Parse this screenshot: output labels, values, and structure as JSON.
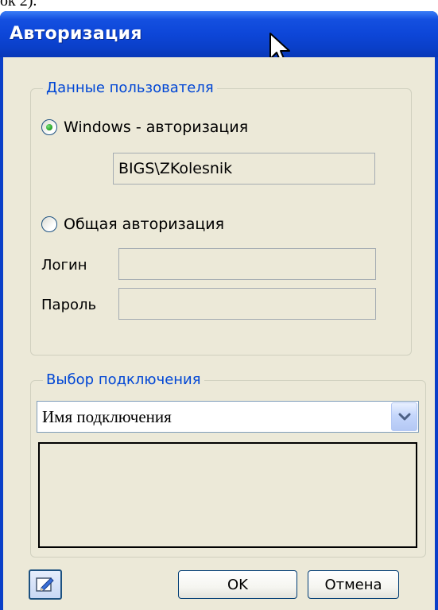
{
  "page_fragment": "ок 2).",
  "window": {
    "title": "Авторизация"
  },
  "user_group": {
    "legend": "Данные пользователя",
    "windows_auth_label": "Windows - авторизация",
    "windows_auth_selected": true,
    "windows_user_value": "BIGS\\ZKolesnik",
    "common_auth_label": "Общая авторизация",
    "common_auth_selected": false,
    "login_label": "Логин",
    "login_value": "",
    "password_label": "Пароль",
    "password_value": ""
  },
  "connection_group": {
    "legend": "Выбор подключения",
    "selected_connection": "Имя подключения"
  },
  "footer": {
    "ok_label": "OK",
    "cancel_label": "Отмена",
    "edit_icon": "edit-icon"
  }
}
